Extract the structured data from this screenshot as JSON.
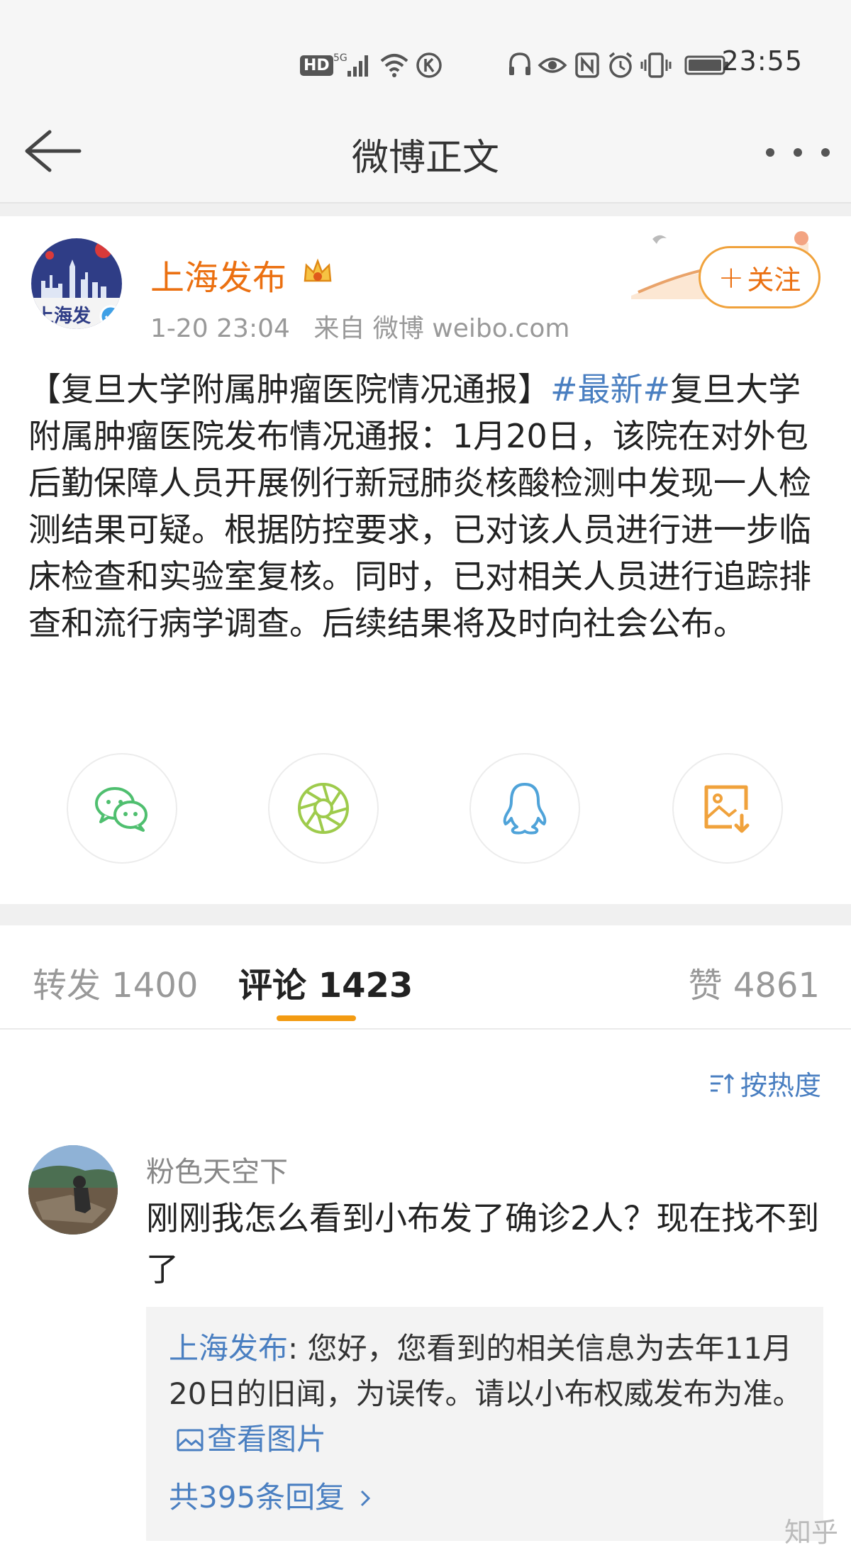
{
  "status_bar": {
    "hd": "HD",
    "net": "5G",
    "time": "23:55"
  },
  "nav": {
    "title": "微博正文"
  },
  "post": {
    "author": "上海发布",
    "avatar_text": "上海发",
    "time": "1-20 23:04",
    "source": "来自 微博 weibo.com",
    "follow_label": "关注",
    "text_prefix": "【复旦大学附属肿瘤医院情况通报】",
    "hashtag": "#最新#",
    "text_body": "复旦大学附属肿瘤医院发布情况通报：1月20日，该院在对外包后勤保障人员开展例行新冠肺炎核酸检测中发现一人检测结果可疑。根据防控要求，已对该人员进行进一步临床检查和实验室复核。同时，已对相关人员进行追踪排查和流行病学调查。后续结果将及时向社会公布。"
  },
  "share": [
    {
      "icon": "wechat-icon",
      "color": "#4fbf6f"
    },
    {
      "icon": "moments-icon",
      "color": "#9ecb4c"
    },
    {
      "icon": "qq-icon",
      "color": "#4fa3d9"
    },
    {
      "icon": "save-image-icon",
      "color": "#f0a23c"
    }
  ],
  "tabs": {
    "repost": "转发 1400",
    "comment": "评论 1423",
    "like": "赞 4861"
  },
  "sort_label": "按热度",
  "comment": {
    "user": "粉色天空下",
    "text": "刚刚我怎么看到小布发了确诊2人？现在找不到了",
    "reply_user": "上海发布",
    "reply_text": ": 您好，您看到的相关信息为去年11月20日的旧闻，为误传。请以小布权威发布为准。",
    "reply_link": "查看图片",
    "reply_count": "共395条回复"
  },
  "watermark": "知乎",
  "colors": {
    "orange": "#eb7011",
    "link_blue": "#4a7fc1",
    "accent_underline": "#f39b12"
  }
}
